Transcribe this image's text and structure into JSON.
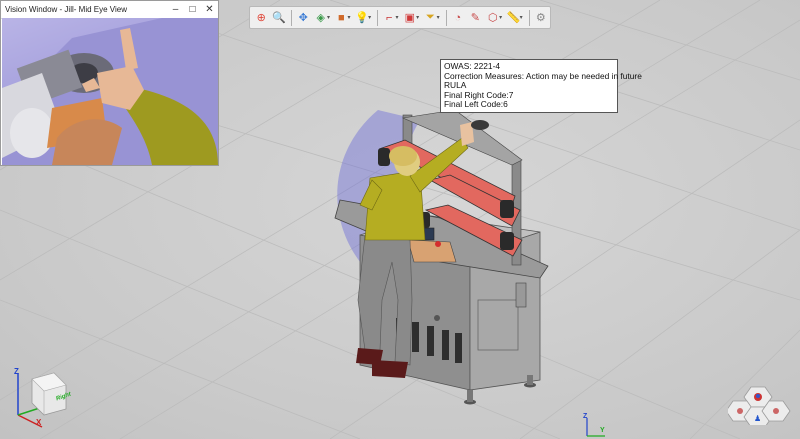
{
  "vision_window": {
    "title": "Vision Window - Jill- Mid Eye View",
    "minimize": "–",
    "maximize": "□",
    "close": "✕"
  },
  "toolbar": {
    "buttons": [
      {
        "name": "zoom-fit-icon",
        "glyph": "⊕",
        "color": "#e0483a"
      },
      {
        "name": "zoom-icon",
        "glyph": "🔍",
        "color": "#2a64c8"
      },
      {
        "name": "pan-icon",
        "glyph": "✥",
        "color": "#3a7bd5"
      },
      {
        "name": "view-cube-icon",
        "glyph": "◈",
        "color": "#3a9a4a"
      },
      {
        "name": "render-style-icon",
        "glyph": "■",
        "color": "#d06a2a"
      },
      {
        "name": "light-icon",
        "glyph": "💡",
        "color": "#e3b52a"
      },
      {
        "name": "measure-icon",
        "glyph": "⌐",
        "color": "#c83030"
      },
      {
        "name": "select-box-icon",
        "glyph": "▣",
        "color": "#d03838"
      },
      {
        "name": "filter-icon",
        "glyph": "⏷",
        "color": "#d7a520"
      },
      {
        "name": "snapshot-icon",
        "glyph": "◔",
        "color": "#c84a4a"
      },
      {
        "name": "mark-icon",
        "glyph": "✎",
        "color": "#c84a4a"
      },
      {
        "name": "annotate-icon",
        "glyph": "⬡",
        "color": "#c84a4a"
      },
      {
        "name": "ruler-icon",
        "glyph": "📏",
        "color": "#c8a23a"
      },
      {
        "name": "settings-icon",
        "glyph": "⚙",
        "color": "#888888"
      }
    ]
  },
  "tooltip": {
    "line1": "OWAS:  2221-4",
    "line2": "Correction Measures: Action may be needed in future",
    "line3": "RULA",
    "line4": "Final Right Code:7",
    "line5": "Final Left Code:6"
  },
  "axes": {
    "z": "Z",
    "y": "Y",
    "x": "X",
    "cube_face": "Right"
  }
}
